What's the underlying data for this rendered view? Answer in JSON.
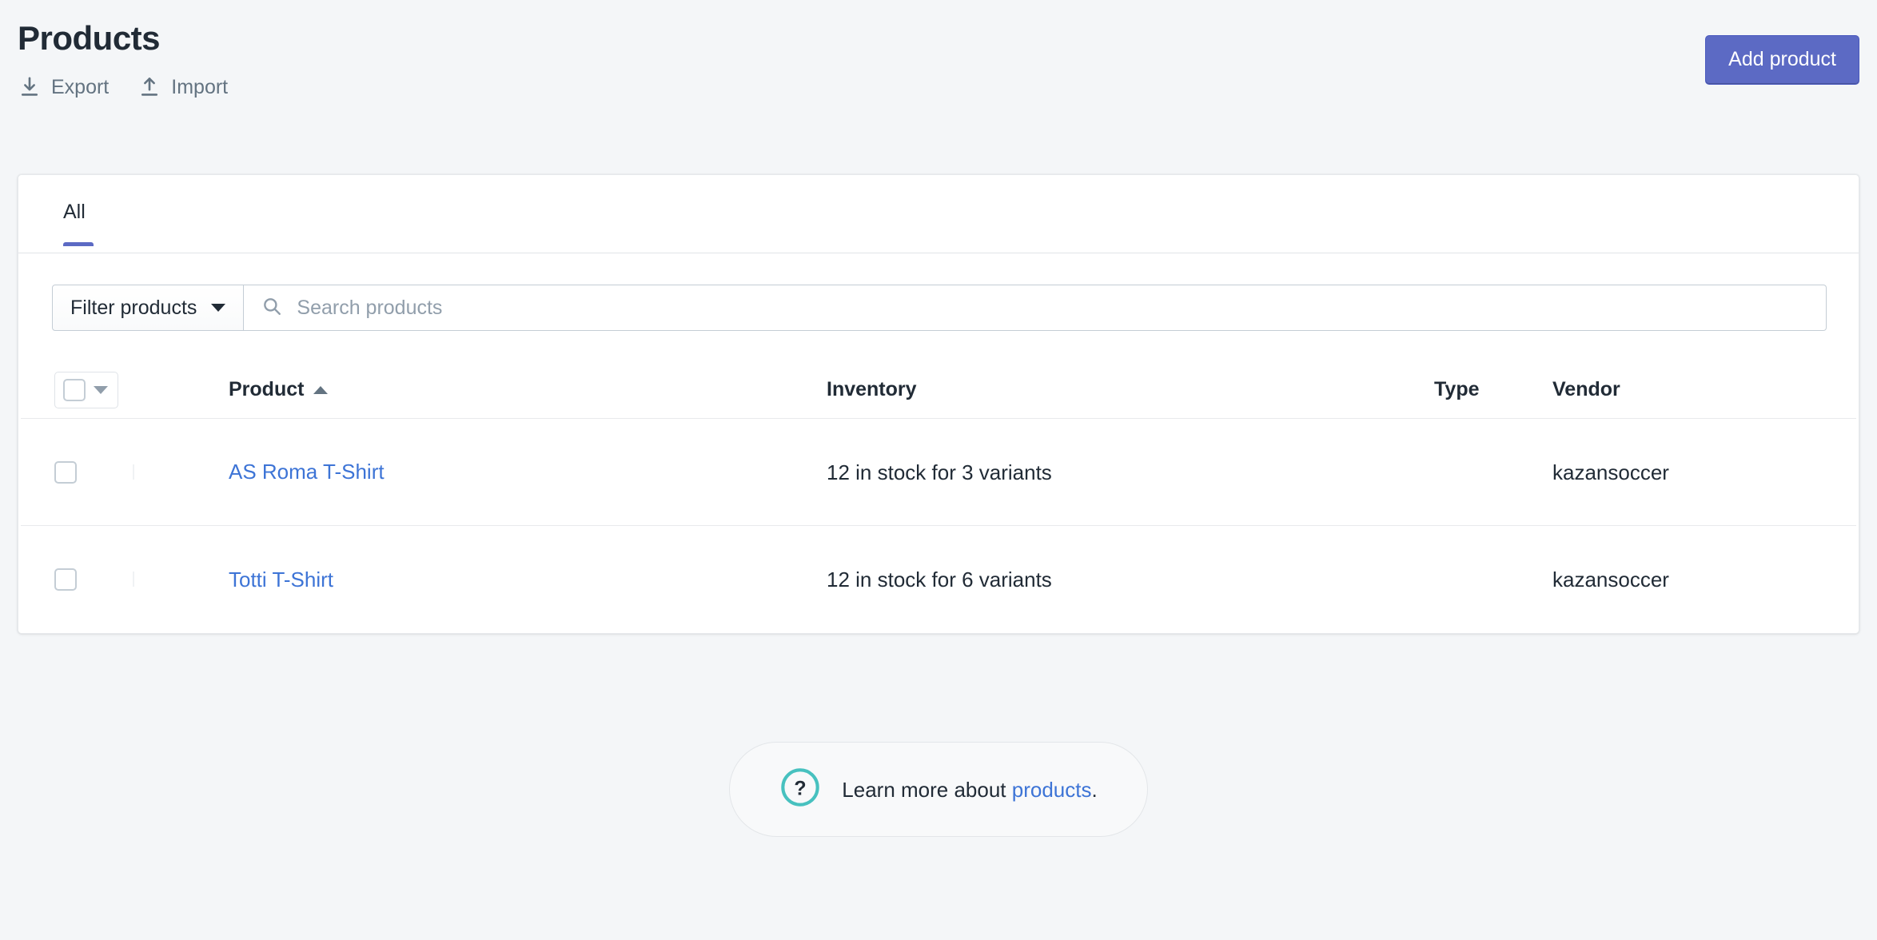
{
  "header": {
    "title": "Products",
    "export_label": "Export",
    "import_label": "Import",
    "add_product_label": "Add product"
  },
  "tabs": [
    {
      "label": "All",
      "selected": true
    }
  ],
  "filters": {
    "filter_label": "Filter products",
    "search_placeholder": "Search products",
    "search_value": ""
  },
  "table": {
    "columns": {
      "product": "Product",
      "inventory": "Inventory",
      "type": "Type",
      "vendor": "Vendor"
    },
    "sort_column": "Product",
    "sort_direction": "ascending",
    "rows": [
      {
        "name": "AS Roma T-Shirt",
        "inventory": "12 in stock for 3 variants",
        "type": "",
        "vendor": "kazansoccer",
        "selected": false
      },
      {
        "name": "Totti T-Shirt",
        "inventory": "12 in stock for 6 variants",
        "type": "",
        "vendor": "kazansoccer",
        "selected": false
      }
    ]
  },
  "footer": {
    "help_text_prefix": "Learn more about ",
    "help_link": "products",
    "help_text_suffix": "."
  },
  "colors": {
    "page_background": "#f4f6f8",
    "primary_button": "#5c6ac4",
    "tab_indicator": "#5c6ac4",
    "link": "#3d74d6",
    "help_icon": "#47c1bf",
    "text": "#212b36",
    "subdued_text": "#637381"
  }
}
